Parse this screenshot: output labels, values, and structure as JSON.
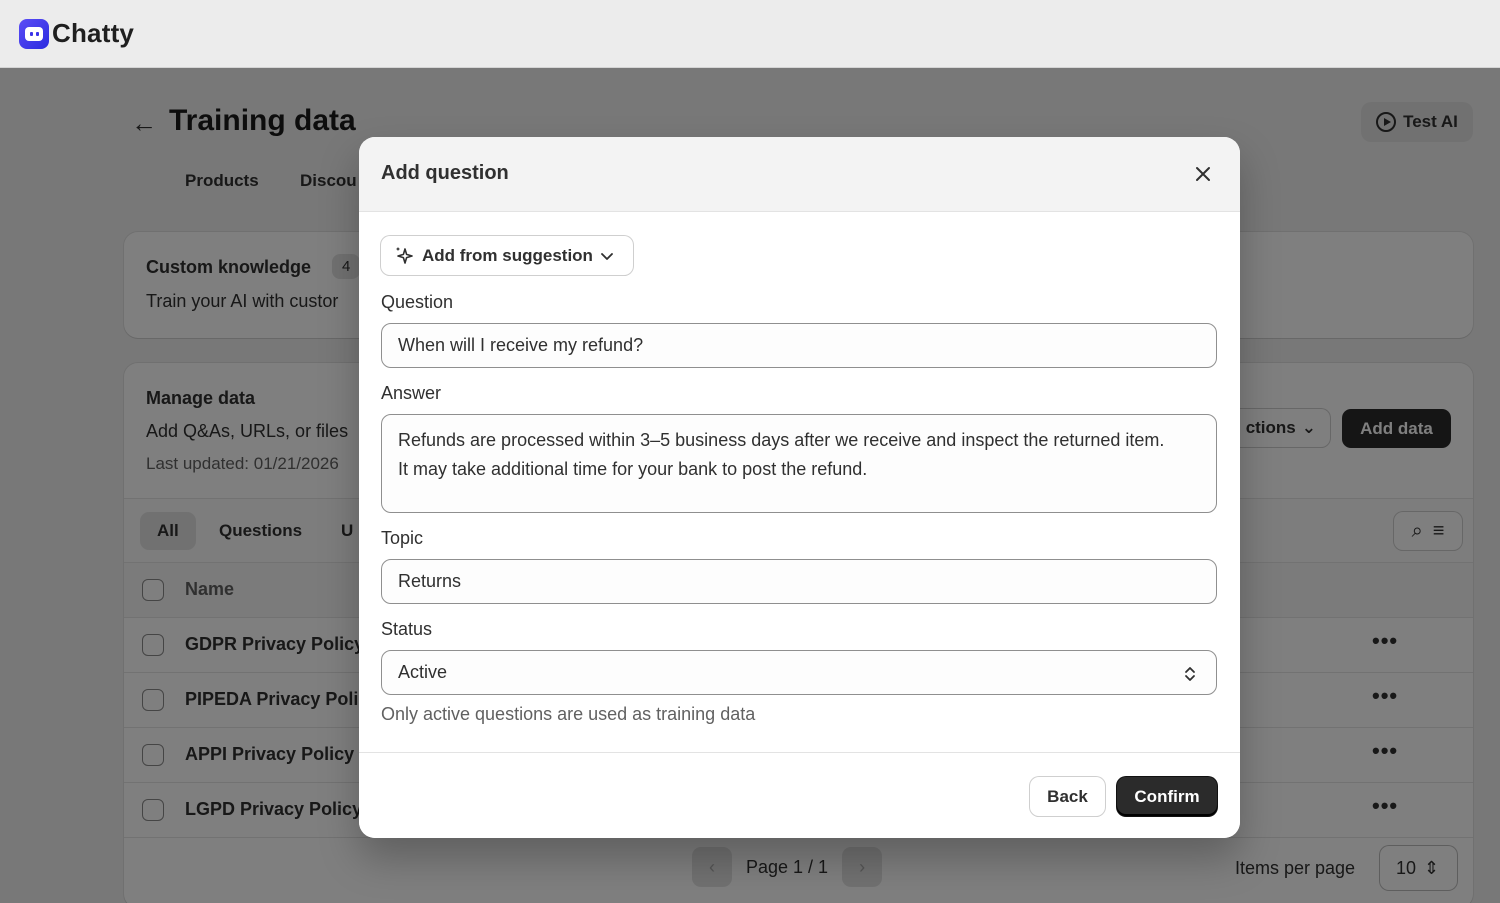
{
  "app": {
    "name": "Chatty"
  },
  "page": {
    "title": "Training data",
    "test_ai_label": "Test AI",
    "tabs": [
      "Products",
      "Discou"
    ],
    "custom_knowledge": {
      "title": "Custom knowledge",
      "count": "4",
      "subtitle": "Train your AI with custor"
    },
    "manage_data": {
      "title": "Manage data",
      "subtitle": "Add Q&As, URLs, or files",
      "last_updated": "Last updated: 01/21/2026",
      "actions_label": "ctions",
      "add_data_label": "Add data",
      "filters": [
        "All",
        "Questions",
        "U"
      ],
      "table_header": "Name",
      "rows": [
        "GDPR Privacy Policy",
        "PIPEDA Privacy Poli",
        "APPI Privacy Policy",
        "LGPD Privacy Policy"
      ],
      "pagination": "Page 1 / 1",
      "items_per_page_label": "Items per page",
      "items_per_page_value": "10"
    }
  },
  "modal": {
    "title": "Add question",
    "suggestion_label": "Add from suggestion",
    "question": {
      "label": "Question",
      "value": "When will I receive my refund?"
    },
    "answer": {
      "label": "Answer",
      "value": "Refunds are processed within 3–5 business days after we receive and inspect the returned item.\nIt may take additional time for your bank to post the refund."
    },
    "topic": {
      "label": "Topic",
      "value": "Returns"
    },
    "status": {
      "label": "Status",
      "value": "Active",
      "help": "Only active questions are used as training data"
    },
    "back_label": "Back",
    "confirm_label": "Confirm"
  },
  "colors": {
    "brand": "#3a33e8",
    "primary_button": "#2b2b2b",
    "overlay": "rgba(0,0,0,0.5)"
  }
}
